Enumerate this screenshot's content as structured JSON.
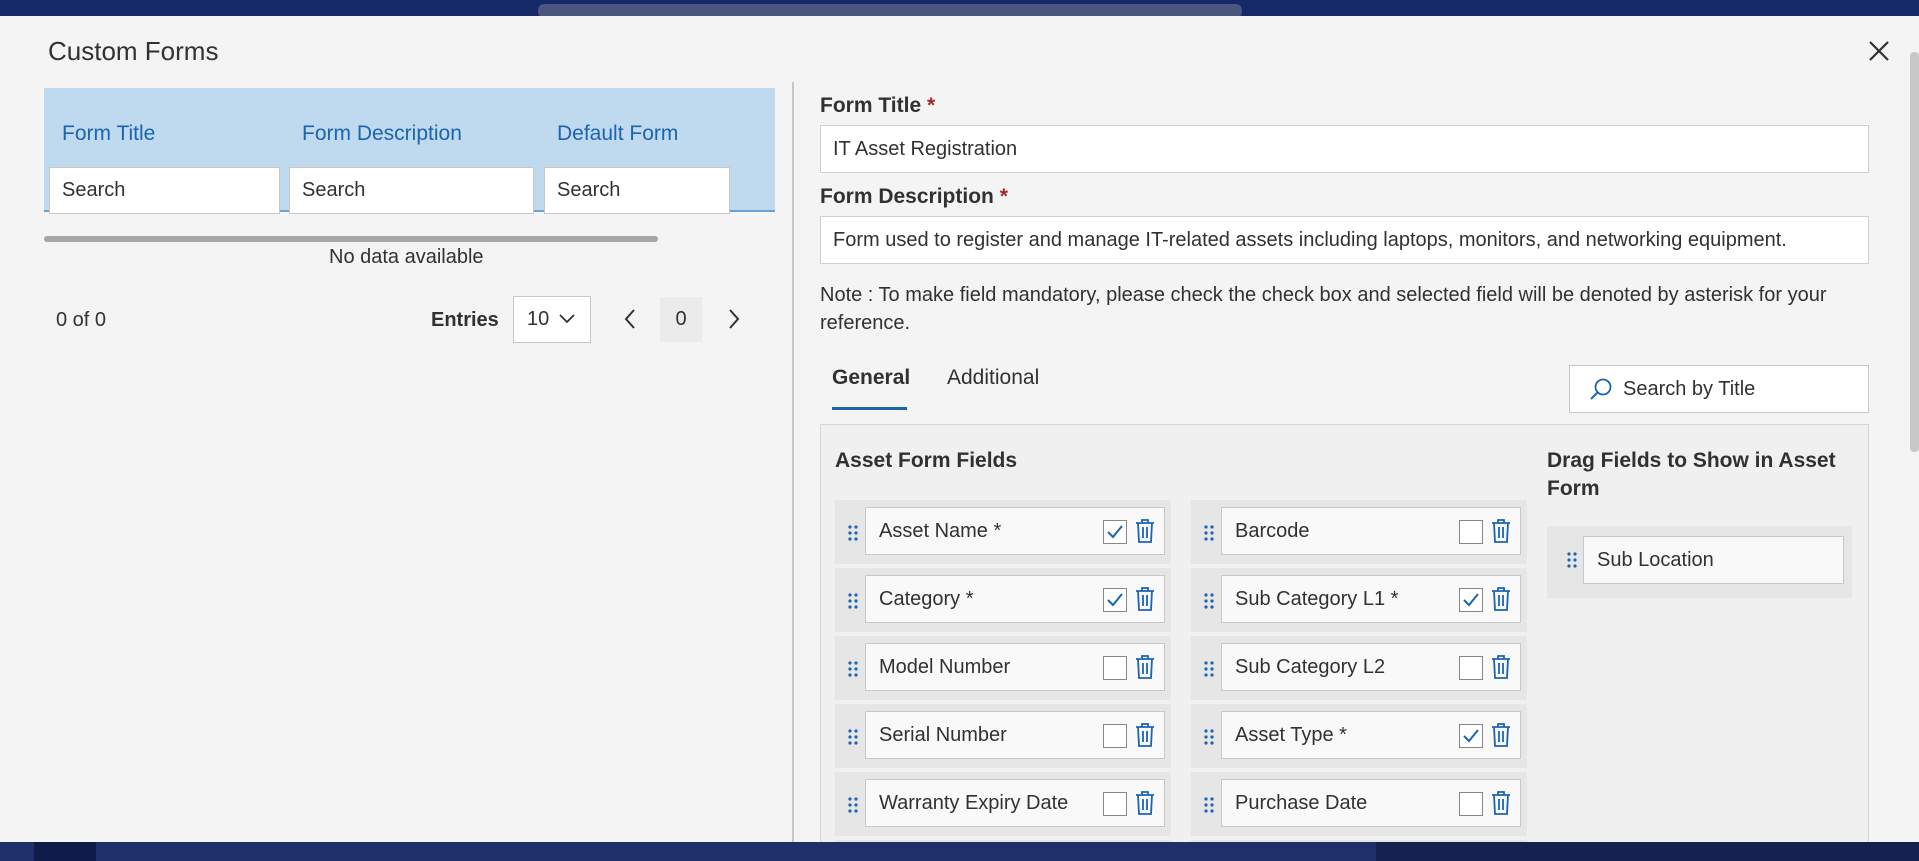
{
  "dialog": {
    "title": "Custom Forms",
    "close_icon": "close-icon"
  },
  "grid": {
    "columns": [
      "Form Title",
      "Form Description",
      "Default Form"
    ],
    "search_placeholder": "Search",
    "empty_text": "No data available",
    "count_text": "0 of 0",
    "entries_label": "Entries",
    "entries_value": "10",
    "page_number": "0"
  },
  "form": {
    "title_label": "Form Title",
    "title_value": "IT Asset Registration",
    "description_label": "Form Description",
    "description_value": "Form used to register and manage IT-related assets including laptops, monitors, and networking equipment.",
    "required_mark": "*",
    "note": "Note : To make field mandatory, please check the check box and selected field will be denoted by asterisk for your reference.",
    "tabs": [
      {
        "label": "General",
        "active": true
      },
      {
        "label": "Additional",
        "active": false
      }
    ],
    "search_title_placeholder": "Search by Title",
    "asset_fields_heading": "Asset Form Fields",
    "drag_heading": "Drag Fields to Show in Asset Form",
    "left_fields": [
      {
        "label": "Asset Name *",
        "checked": true
      },
      {
        "label": "Category *",
        "checked": true
      },
      {
        "label": "Model Number",
        "checked": false
      },
      {
        "label": "Serial Number",
        "checked": false
      },
      {
        "label": "Warranty Expiry Date",
        "checked": false
      },
      {
        "label": "",
        "checked": false
      }
    ],
    "right_fields": [
      {
        "label": "Barcode",
        "checked": false
      },
      {
        "label": "Sub Category L1 *",
        "checked": true
      },
      {
        "label": "Sub Category L2",
        "checked": false
      },
      {
        "label": "Asset Type *",
        "checked": true
      },
      {
        "label": "Purchase Date",
        "checked": false
      },
      {
        "label": "",
        "checked": false
      }
    ],
    "available_fields": [
      {
        "label": "Sub Location"
      }
    ]
  },
  "colors": {
    "accent": "#1b64b0",
    "header_bg": "#bfd9ef",
    "required": "#a4262c"
  }
}
